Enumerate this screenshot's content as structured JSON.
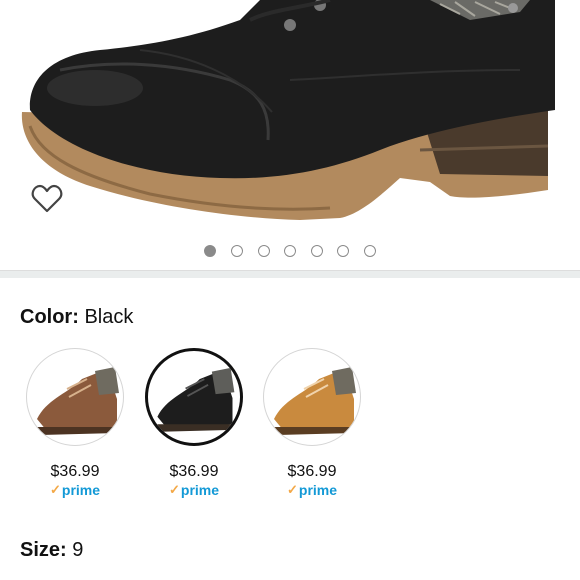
{
  "product": {
    "image_alt": "black lace-up combat boot",
    "colors": {
      "black": "#1d1d1d",
      "sole": "#b28a5e",
      "prime_blue": "#1399d6",
      "prime_check": "#f3a847"
    }
  },
  "carousel": {
    "total": 7,
    "active_index": 0
  },
  "wishlist": {
    "icon": "heart-outline-icon"
  },
  "color_selector": {
    "label": "Color:",
    "value": "Black",
    "options": [
      {
        "name": "brown",
        "price": "$36.99",
        "prime": "prime",
        "selected": false
      },
      {
        "name": "black",
        "price": "$36.99",
        "prime": "prime",
        "selected": true
      },
      {
        "name": "tan",
        "price": "$36.99",
        "prime": "prime",
        "selected": false
      }
    ]
  },
  "size_selector": {
    "label": "Size:",
    "value": "9"
  }
}
